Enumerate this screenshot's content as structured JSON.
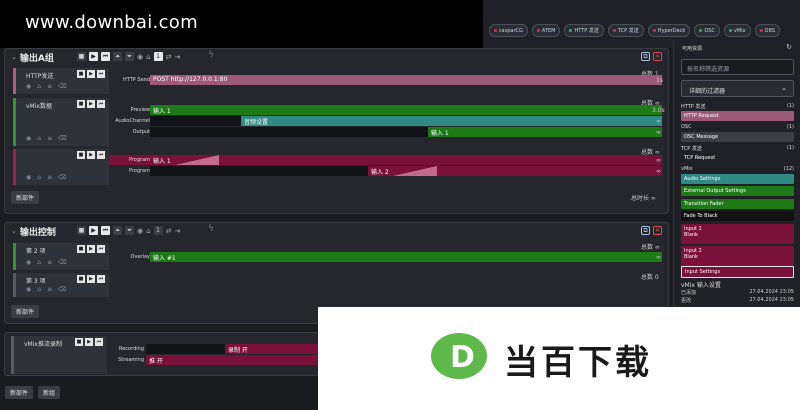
{
  "site_banner": "www.downbai.com",
  "status_chips": [
    "casparCG",
    "ATEM",
    "HTTP 发送",
    "TCP 发送",
    "HyperDeck",
    "OSC",
    "vMix",
    "OBS"
  ],
  "group1": {
    "title": "输出A组",
    "new_part": "新部件",
    "total_length": "总时长 ∞",
    "items": [
      {
        "name": "HTTP发送",
        "total": "总数 1",
        "lane_label": "HTTP Send",
        "bar": "POST http://127.0.0.1:80",
        "end": "1s"
      },
      {
        "name": "vMix数据",
        "total": "总数 ∞",
        "lanes": [
          {
            "label": "Preview",
            "bar": "输入 1",
            "end": "3.0s"
          },
          {
            "label": "AudioChannel",
            "bar": "音频设置",
            "end": "∞"
          },
          {
            "label": "Output",
            "bar": "输入 1",
            "end": "∞"
          }
        ]
      },
      {
        "name": "",
        "total": "总数 ∞",
        "lanes": [
          {
            "label": "Program",
            "bar": "输入 1",
            "end": "∞"
          },
          {
            "label": "Program",
            "bar": "输入 2",
            "end": "∞"
          }
        ]
      }
    ]
  },
  "group2": {
    "title": "输出控制",
    "new_part": "新部件",
    "items": [
      {
        "name": "第 2 项",
        "total": "总数 ∞",
        "lane_label": "Overlay",
        "bar": "输入 #1",
        "end": "∞"
      },
      {
        "name": "第 3 项",
        "total": "总数 0"
      }
    ]
  },
  "group3": {
    "item_name": "vMix推流录制",
    "lanes": [
      {
        "label": "Recording",
        "bar": "录制 开"
      },
      {
        "label": "Streaming",
        "bar": "推 开"
      }
    ]
  },
  "bottom": {
    "new_part": "新部件",
    "new_group": "新组"
  },
  "right_panel": {
    "title": "可用资源",
    "search_placeholder": "按名称筛选资源",
    "filter_label": "详细的过滤器",
    "categories": [
      {
        "name": "HTTP 发送",
        "count": "(1)"
      },
      {
        "name": "OSC",
        "count": "(1)"
      },
      {
        "name": "TCP 发送",
        "count": "(1)"
      },
      {
        "name": "vMix",
        "count": "(12)"
      }
    ],
    "resources": {
      "http": "HTTP Request",
      "osc": "OSC Message",
      "tcp": "TCP Request",
      "vmix": [
        "Audio Settings",
        "External Output Settings",
        "Transition Fader",
        "Fade To Black"
      ],
      "input1": "Input 1",
      "input1_sub": "Blank",
      "input2": "Input 2",
      "input2_sub": "Blank",
      "input_settings": "Input Settings"
    },
    "info_title": "vMix 输入设置",
    "info_rows": [
      {
        "k": "已添加",
        "v": "27.04.2024 23:05"
      },
      {
        "k": "更改",
        "v": "27.04.2024 23:05"
      }
    ]
  },
  "overlay_brand": "当百下载",
  "colors": {
    "green": "#1e7a17",
    "teal": "#2e8a82",
    "crimson": "#7a1138",
    "pink": "#9c5a78"
  }
}
